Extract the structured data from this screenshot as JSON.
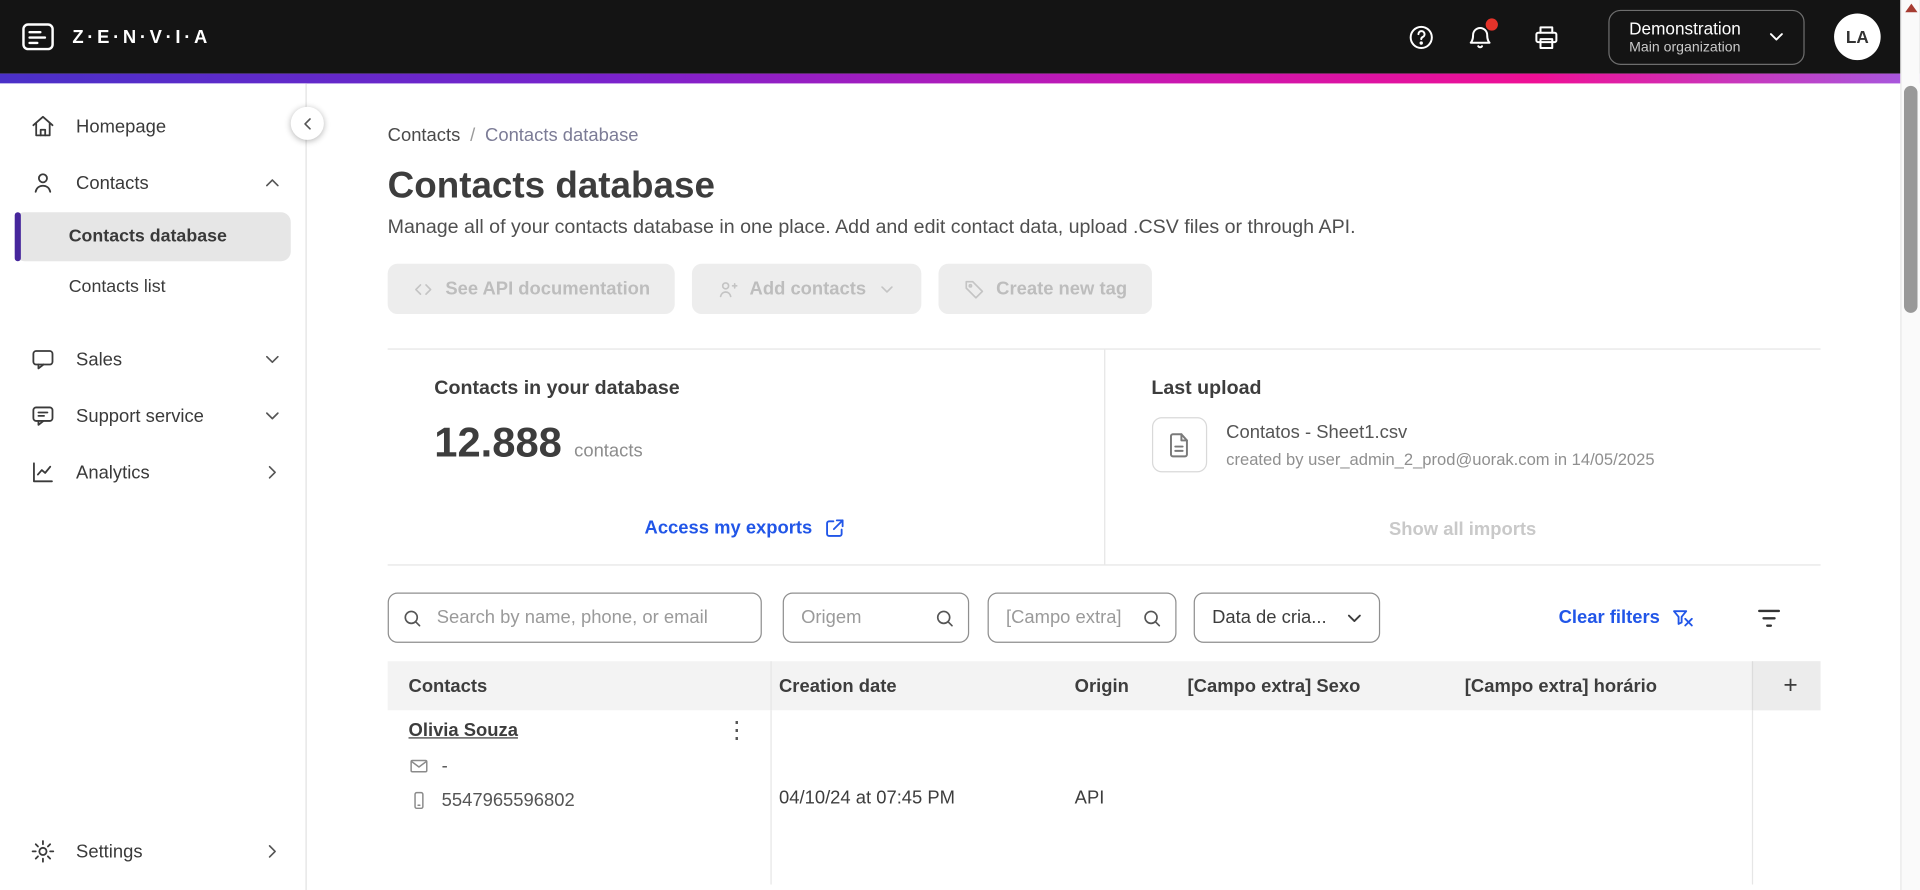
{
  "topbar": {
    "brand": "Z·E·N·V·I·A",
    "org": {
      "name": "Demonstration",
      "sub": "Main organization"
    },
    "avatar_initials": "LA"
  },
  "sidebar": {
    "items": [
      {
        "label": "Homepage"
      },
      {
        "label": "Contacts"
      },
      {
        "label": "Contacts database"
      },
      {
        "label": "Contacts list"
      },
      {
        "label": "Sales"
      },
      {
        "label": "Support service"
      },
      {
        "label": "Analytics"
      },
      {
        "label": "Settings"
      }
    ]
  },
  "breadcrumb": {
    "parent": "Contacts",
    "separator": "/",
    "current": "Contacts database"
  },
  "page": {
    "title": "Contacts database",
    "subtitle": "Manage all of your contacts database in one place. Add and edit contact data, upload .CSV files or through API."
  },
  "actions": {
    "see_api": "See API documentation",
    "add_contacts": "Add contacts",
    "create_tag": "Create new tag"
  },
  "stats": {
    "contacts_panel": {
      "title": "Contacts in your database",
      "count": "12.888",
      "unit": "contacts",
      "link": "Access my exports"
    },
    "upload_panel": {
      "title": "Last upload",
      "filename": "Contatos - Sheet1.csv",
      "meta": "created by user_admin_2_prod@uorak.com in 14/05/2025",
      "link": "Show all imports"
    }
  },
  "filters": {
    "search_placeholder": "Search by name, phone, or email",
    "origem_placeholder": "Origem",
    "campo_extra_placeholder": "[Campo extra]",
    "date_label": "Data de cria...",
    "clear_label": "Clear filters"
  },
  "table": {
    "headers": [
      "Contacts",
      "Creation date",
      "Origin",
      "[Campo extra] Sexo",
      "[Campo extra] horário"
    ],
    "add_column_label": "+",
    "rows": [
      {
        "name": "Olivia Souza",
        "email": "-",
        "phone": "5547965596802",
        "creation_date": "04/10/24 at 07:45 PM",
        "origin": "API"
      }
    ]
  },
  "icons": {
    "kebab": "⋮"
  },
  "colors": {
    "topbar_bg": "#141414",
    "accent_blue": "#2156e8",
    "selected_purple": "#46269c",
    "notification_red": "#e5332a",
    "gradient": [
      "#4a30c8",
      "#c318b4",
      "#ef0f95",
      "#a45ae0"
    ]
  }
}
